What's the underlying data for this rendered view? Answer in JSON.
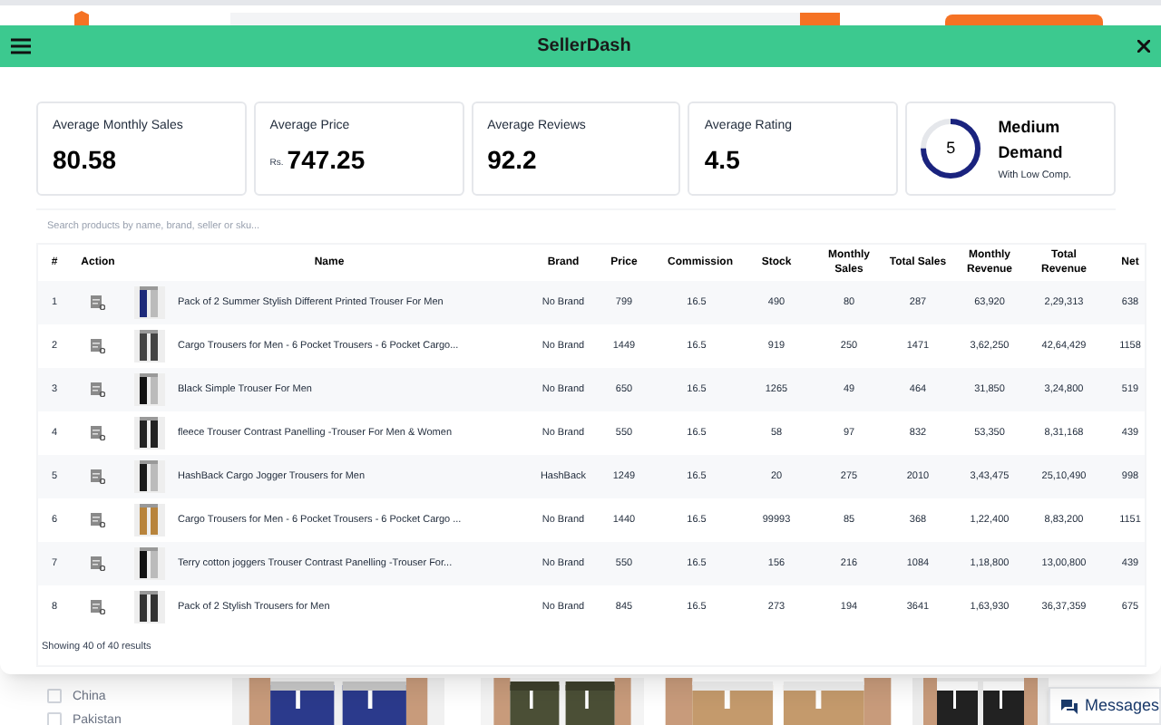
{
  "background_page": {
    "filters": [
      {
        "label": "China",
        "checked": false
      },
      {
        "label": "Pakistan",
        "checked": false
      }
    ],
    "messages_button": "Messages"
  },
  "dialog": {
    "title": "SellerDash",
    "stats": [
      {
        "label": "Average Monthly Sales",
        "value": "80.58"
      },
      {
        "label": "Average Price",
        "prefix": "Rs.",
        "value": "747.25"
      },
      {
        "label": "Average Reviews",
        "value": "92.2"
      },
      {
        "label": "Average Rating",
        "value": "4.5"
      }
    ],
    "demand": {
      "score": "5",
      "level": 0.75,
      "title": "Medium Demand",
      "subtitle": "With Low Comp."
    },
    "search": {
      "placeholder": "Search products by name, brand, seller or sku..."
    },
    "table": {
      "columns": [
        "#",
        "Action",
        "Name",
        "Brand",
        "Price",
        "Commission",
        "Stock",
        "Monthly Sales",
        "Total Sales",
        "Monthly Revenue",
        "Total Revenue",
        "Net"
      ],
      "rows": [
        {
          "cells": [
            "1",
            "",
            "Pack of 2 Summer Stylish Different Printed Trouser For Men",
            "No Brand",
            "799",
            "16.5",
            "490",
            "80",
            "287",
            "63,920",
            "2,29,313",
            "638"
          ]
        },
        {
          "cells": [
            "2",
            "",
            "Cargo Trousers for Men - 6 Pocket Trousers - 6 Pocket Cargo...",
            "No Brand",
            "1449",
            "16.5",
            "919",
            "250",
            "1471",
            "3,62,250",
            "42,64,429",
            "1158"
          ]
        },
        {
          "cells": [
            "3",
            "",
            "Black Simple Trouser For Men",
            "No Brand",
            "650",
            "16.5",
            "1265",
            "49",
            "464",
            "31,850",
            "3,24,800",
            "519"
          ]
        },
        {
          "cells": [
            "4",
            "",
            "fleece Trouser Contrast Panelling -Trouser For Men & Women",
            "No Brand",
            "550",
            "16.5",
            "58",
            "97",
            "832",
            "53,350",
            "8,31,168",
            "439"
          ]
        },
        {
          "cells": [
            "5",
            "",
            "HashBack Cargo Jogger Trousers for Men",
            "HashBack",
            "1249",
            "16.5",
            "20",
            "275",
            "2010",
            "3,43,475",
            "25,10,490",
            "998"
          ]
        },
        {
          "cells": [
            "6",
            "",
            "Cargo Trousers for Men - 6 Pocket Trousers - 6 Pocket Cargo ...",
            "No Brand",
            "1440",
            "16.5",
            "99993",
            "85",
            "368",
            "1,22,400",
            "8,83,200",
            "1151"
          ]
        },
        {
          "cells": [
            "7",
            "",
            "Terry cotton joggers Trouser Contrast Panelling -Trouser For...",
            "No Brand",
            "550",
            "16.5",
            "156",
            "216",
            "1084",
            "1,18,800",
            "13,00,800",
            "439"
          ]
        },
        {
          "cells": [
            "8",
            "",
            "Pack of 2 Stylish Trousers for Men",
            "No Brand",
            "845",
            "16.5",
            "273",
            "194",
            "3641",
            "1,63,930",
            "36,37,359",
            "675"
          ]
        }
      ]
    },
    "footer": "Showing 40 of 40 results"
  }
}
